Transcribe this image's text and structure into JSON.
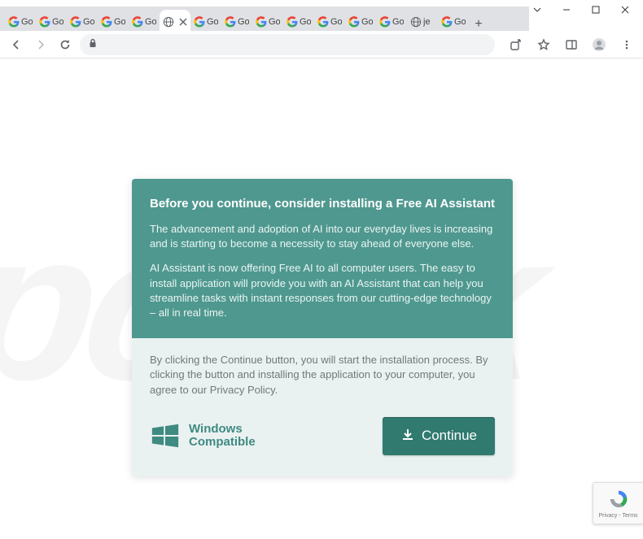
{
  "window": {
    "controls": {
      "chevron": "⌄",
      "minimize": "—",
      "maximize": "☐",
      "close": "✕"
    }
  },
  "tabs": {
    "items": [
      {
        "label": "Go",
        "favicon": "google"
      },
      {
        "label": "Go",
        "favicon": "google"
      },
      {
        "label": "Go",
        "favicon": "google"
      },
      {
        "label": "Go",
        "favicon": "google"
      },
      {
        "label": "Go",
        "favicon": "google"
      },
      {
        "label": "",
        "favicon": "globe",
        "active": true
      },
      {
        "label": "Go",
        "favicon": "google"
      },
      {
        "label": "Go",
        "favicon": "google"
      },
      {
        "label": "Go",
        "favicon": "google"
      },
      {
        "label": "Go",
        "favicon": "google"
      },
      {
        "label": "Go",
        "favicon": "google"
      },
      {
        "label": "Go",
        "favicon": "google"
      },
      {
        "label": "Go",
        "favicon": "google"
      },
      {
        "label": "je",
        "favicon": "globe"
      },
      {
        "label": "Go",
        "favicon": "google"
      }
    ],
    "newtab": "+"
  },
  "toolbar": {
    "back": "←",
    "forward": "→",
    "reload": "⟳",
    "lock": "secure",
    "share": "share",
    "bookmark": "star",
    "side_panel": "panel",
    "profile": "profile",
    "menu": "⋮"
  },
  "popup": {
    "heading": "Before you continue, consider installing a Free AI Assistant",
    "para1": "The advancement and adoption of AI into our everyday lives is increasing and is starting to become a necessity to stay ahead of everyone else.",
    "para2": "AI Assistant is now offering Free AI to all computer users. The easy to install application will provide you with an AI Assistant that can help you streamline tasks with instant responses from our cutting-edge technology – all in real time.",
    "disclaimer": "By clicking the Continue button, you will start the installation process. By clicking the button and installing the application to your computer, you agree to our Privacy Policy.",
    "compat_line1": "Windows",
    "compat_line2": "Compatible",
    "continue_label": "Continue"
  },
  "recaptcha": {
    "line1": "Privacy - Terms"
  },
  "colors": {
    "teal_dark": "#307a70",
    "teal_mid": "#4f988f",
    "teal_text": "#3f8a81",
    "card_bg": "#eaf2f1"
  }
}
